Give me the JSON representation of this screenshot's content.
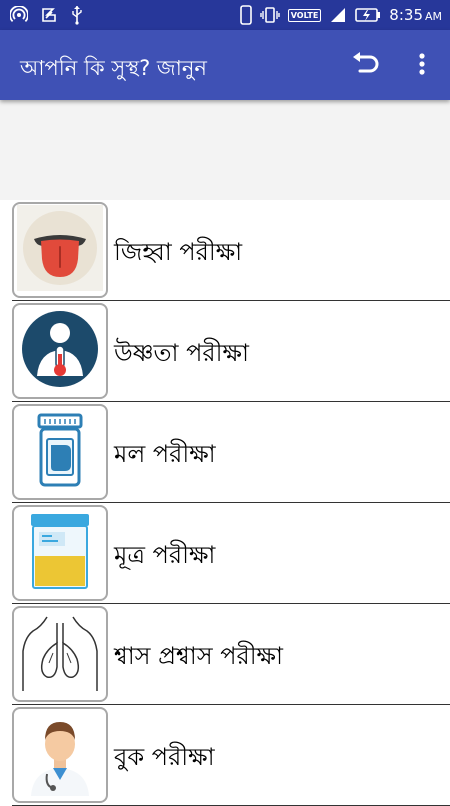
{
  "status_bar": {
    "time": "8:35",
    "ampm": "AM",
    "network_label": "VOLTE"
  },
  "app_bar": {
    "title": "আপনি কি সুস্থ? জানুন"
  },
  "items": [
    {
      "label": "জিহ্বা পরীক্ষা",
      "icon": "tongue-icon"
    },
    {
      "label": "উষ্ণতা পরীক্ষা",
      "icon": "thermometer-icon"
    },
    {
      "label": "মল পরীক্ষা",
      "icon": "stool-container-icon"
    },
    {
      "label": "মূত্র পরীক্ষা",
      "icon": "urine-container-icon"
    },
    {
      "label": "শ্বাস প্রশ্বাস পরীক্ষা",
      "icon": "lungs-icon"
    },
    {
      "label": "বুক পরীক্ষা",
      "icon": "doctor-icon"
    }
  ],
  "colors": {
    "status_bar": "#27379a",
    "app_bar": "#3f51b5",
    "banner": "#f3f3f3"
  }
}
